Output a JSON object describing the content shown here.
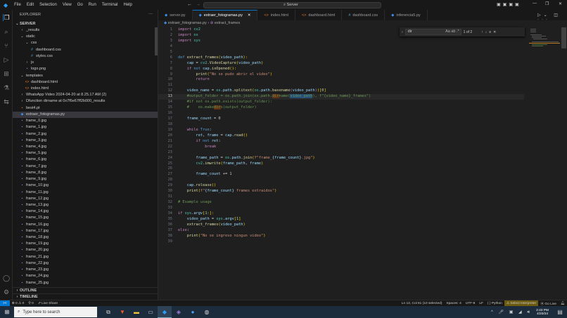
{
  "menu": [
    "File",
    "Edit",
    "Selection",
    "View",
    "Go",
    "Run",
    "Terminal",
    "Help"
  ],
  "search_text": "Server",
  "explorer": {
    "title": "EXPLORER",
    "root": "SERVER",
    "items": [
      {
        "label": "_results",
        "depth": 1,
        "icon": "chevron-right",
        "kind": "folder"
      },
      {
        "label": "static",
        "depth": 1,
        "icon": "chevron-down",
        "kind": "folder"
      },
      {
        "label": "css",
        "depth": 2,
        "icon": "chevron-down",
        "kind": "folder"
      },
      {
        "label": "dashboard.css",
        "depth": 3,
        "icon": "#",
        "kind": "css"
      },
      {
        "label": "styles.css",
        "depth": 3,
        "icon": "#",
        "kind": "css"
      },
      {
        "label": "js",
        "depth": 2,
        "icon": "chevron-right",
        "kind": "folder"
      },
      {
        "label": "logo.png",
        "depth": 2,
        "icon": "img",
        "kind": "png"
      },
      {
        "label": "templates",
        "depth": 1,
        "icon": "chevron-down",
        "kind": "folder"
      },
      {
        "label": "dashboard.html",
        "depth": 2,
        "icon": "<>",
        "kind": "html"
      },
      {
        "label": "index.html",
        "depth": 2,
        "icon": "<>",
        "kind": "html"
      },
      {
        "label": "WhatsApp Video 2024-04-20 at 8.25.17 AM (2)",
        "depth": 1,
        "icon": "chevron-right",
        "kind": "folder"
      },
      {
        "label": "Dfunction dirname at 0x7f6e67ff2b000_results",
        "depth": 1,
        "icon": "chevron-right",
        "kind": "folder"
      },
      {
        "label": "best4.pt",
        "depth": 1,
        "icon": "file",
        "kind": "pt"
      },
      {
        "label": "extraer_fotogramas.py",
        "depth": 1,
        "icon": "py",
        "kind": "py",
        "selected": true
      },
      {
        "label": "frame_0.jpg"
      },
      {
        "label": "frame_1.jpg"
      },
      {
        "label": "frame_2.jpg"
      },
      {
        "label": "frame_3.jpg"
      },
      {
        "label": "frame_4.jpg"
      },
      {
        "label": "frame_5.jpg"
      },
      {
        "label": "frame_6.jpg"
      },
      {
        "label": "frame_7.jpg"
      },
      {
        "label": "frame_8.jpg"
      },
      {
        "label": "frame_9.jpg"
      },
      {
        "label": "frame_10.jpg"
      },
      {
        "label": "frame_11.jpg"
      },
      {
        "label": "frame_12.jpg"
      },
      {
        "label": "frame_13.jpg"
      },
      {
        "label": "frame_14.jpg"
      },
      {
        "label": "frame_15.jpg"
      },
      {
        "label": "frame_16.jpg"
      },
      {
        "label": "frame_17.jpg"
      },
      {
        "label": "frame_18.jpg"
      },
      {
        "label": "frame_19.jpg"
      },
      {
        "label": "frame_20.jpg"
      },
      {
        "label": "frame_21.jpg"
      },
      {
        "label": "frame_22.jpg"
      },
      {
        "label": "frame_23.jpg"
      },
      {
        "label": "frame_24.jpg"
      },
      {
        "label": "frame_25.jpg"
      }
    ],
    "outline": "OUTLINE",
    "timeline": "TIMELINE"
  },
  "tabs": [
    {
      "label": "server.py",
      "kind": "py"
    },
    {
      "label": "extraer_fotogramas.py",
      "kind": "py",
      "active": true
    },
    {
      "label": "index.html",
      "kind": "html"
    },
    {
      "label": "dashboard.html",
      "kind": "html"
    },
    {
      "label": "dashboard.css",
      "kind": "css"
    },
    {
      "label": "inferencia5.py",
      "kind": "py"
    }
  ],
  "breadcrumb": {
    "file": "extraer_fotogramas.py",
    "symbol": "extract_frames"
  },
  "find": {
    "query": "dir",
    "options": "Aa ab .*",
    "count": "1 of 2"
  },
  "current_line": 13,
  "code": [
    [
      [
        "import ",
        "k"
      ],
      [
        "cv2",
        "m"
      ]
    ],
    [
      [
        "import ",
        "k"
      ],
      [
        "os",
        "m"
      ]
    ],
    [
      [
        "import ",
        "k"
      ],
      [
        "sys",
        "m"
      ]
    ],
    [],
    [],
    [
      [
        "def ",
        "d"
      ],
      [
        "extract_frames",
        "f"
      ],
      [
        "(",
        "b"
      ],
      [
        "video_path",
        "v"
      ],
      [
        "):",
        "b"
      ]
    ],
    [
      [
        "    cap ",
        "v"
      ],
      [
        "= ",
        "p"
      ],
      [
        "cv2",
        "m"
      ],
      [
        ".",
        "p"
      ],
      [
        "VideoCapture",
        "f"
      ],
      [
        "(",
        "b"
      ],
      [
        "video_path",
        "v"
      ],
      [
        ")",
        "b"
      ]
    ],
    [
      [
        "    if ",
        "k"
      ],
      [
        "not ",
        "d"
      ],
      [
        "cap",
        "v"
      ],
      [
        ".",
        "p"
      ],
      [
        "isOpened",
        "f"
      ],
      [
        "():",
        "b"
      ]
    ],
    [
      [
        "        print",
        "f"
      ],
      [
        "(",
        "b"
      ],
      [
        "\"No se pudo abrir el video\"",
        "s"
      ],
      [
        ")",
        "b"
      ]
    ],
    [
      [
        "        return",
        "k"
      ]
    ],
    [],
    [
      [
        "    video_name ",
        "v"
      ],
      [
        "= ",
        "p"
      ],
      [
        "os",
        "m"
      ],
      [
        ".path.",
        "v"
      ],
      [
        "splitext",
        "f"
      ],
      [
        "(",
        "b"
      ],
      [
        "os",
        "m"
      ],
      [
        ".path.",
        "v"
      ],
      [
        "basename",
        "f"
      ],
      [
        "(",
        "k"
      ],
      [
        "video_path",
        "v"
      ],
      [
        ")",
        "k"
      ],
      [
        ")",
        "b"
      ],
      [
        "[",
        "b"
      ],
      [
        "0",
        "n"
      ],
      [
        "]",
        "b"
      ]
    ],
    [
      [
        "    #output_folder = os.path.join(os.path.",
        "c"
      ],
      [
        "dir",
        "c hl"
      ],
      [
        "name(",
        "c"
      ],
      [
        "video_path",
        "c hs"
      ],
      [
        "), f\"{video_name}_frames\")",
        "c"
      ]
    ],
    [
      [
        "    #if not os.path.exists(output_folder):",
        "c"
      ]
    ],
    [
      [
        "    #    os.make",
        "c"
      ],
      [
        "dir",
        "c hl"
      ],
      [
        "s(output_folder)",
        "c"
      ]
    ],
    [],
    [
      [
        "    frame_count ",
        "v"
      ],
      [
        "= ",
        "p"
      ],
      [
        "0",
        "n"
      ]
    ],
    [],
    [
      [
        "    while ",
        "k"
      ],
      [
        "True",
        "d"
      ],
      [
        ":",
        "p"
      ]
    ],
    [
      [
        "        ret",
        "v"
      ],
      [
        ", ",
        "p"
      ],
      [
        "frame ",
        "v"
      ],
      [
        "= ",
        "p"
      ],
      [
        "cap",
        "v"
      ],
      [
        ".",
        "p"
      ],
      [
        "read",
        "f"
      ],
      [
        "()",
        "b"
      ]
    ],
    [
      [
        "        if ",
        "k"
      ],
      [
        "not ",
        "d"
      ],
      [
        "ret",
        "v"
      ],
      [
        ":",
        "p"
      ]
    ],
    [
      [
        "            break",
        "k"
      ]
    ],
    [],
    [
      [
        "        frame_path ",
        "v"
      ],
      [
        "= ",
        "p"
      ],
      [
        "os",
        "m"
      ],
      [
        ".path.",
        "v"
      ],
      [
        "join",
        "f"
      ],
      [
        "(",
        "b"
      ],
      [
        "f\"frame_",
        "s"
      ],
      [
        "{frame_count}",
        "v"
      ],
      [
        ".jpg\"",
        "s"
      ],
      [
        ")",
        "b"
      ]
    ],
    [
      [
        "        cv2",
        "m"
      ],
      [
        ".",
        "p"
      ],
      [
        "imwrite",
        "f"
      ],
      [
        "(",
        "b"
      ],
      [
        "frame_path",
        "v"
      ],
      [
        ", ",
        "p"
      ],
      [
        "frame",
        "v"
      ],
      [
        ")",
        "b"
      ]
    ],
    [],
    [
      [
        "        frame_count ",
        "v"
      ],
      [
        "+= ",
        "p"
      ],
      [
        "1",
        "n"
      ]
    ],
    [],
    [
      [
        "    cap",
        "v"
      ],
      [
        ".",
        "p"
      ],
      [
        "release",
        "f"
      ],
      [
        "()",
        "b"
      ]
    ],
    [
      [
        "    print",
        "f"
      ],
      [
        "(",
        "b"
      ],
      [
        "f\"",
        "s"
      ],
      [
        "{frame_count}",
        "v"
      ],
      [
        " frames extraidos\"",
        "s"
      ],
      [
        ")",
        "b"
      ]
    ],
    [],
    [
      [
        "# Example usage",
        "c"
      ]
    ],
    [],
    [
      [
        "if ",
        "k"
      ],
      [
        "sys",
        "m"
      ],
      [
        ".",
        "p"
      ],
      [
        "argv",
        "v"
      ],
      [
        "[",
        "b"
      ],
      [
        "1:",
        "n"
      ],
      [
        "]:",
        "b"
      ]
    ],
    [
      [
        "    video_path ",
        "v"
      ],
      [
        "= ",
        "p"
      ],
      [
        "sys",
        "m"
      ],
      [
        ".",
        "p"
      ],
      [
        "argv",
        "v"
      ],
      [
        "[",
        "b"
      ],
      [
        "1",
        "n"
      ],
      [
        "]",
        "b"
      ]
    ],
    [
      [
        "    extract_frames",
        "f"
      ],
      [
        "(",
        "b"
      ],
      [
        "video_path",
        "v"
      ],
      [
        ")",
        "b"
      ]
    ],
    [
      [
        "else",
        "k"
      ],
      [
        ":",
        "p"
      ]
    ],
    [
      [
        "    print",
        "f"
      ],
      [
        "(",
        "b"
      ],
      [
        "\"No se ingreso ningun video\"",
        "s"
      ],
      [
        ")",
        "b"
      ]
    ],
    []
  ],
  "status": {
    "remote": "><",
    "errors": "0",
    "warnings": "0",
    "ports": "0",
    "live_share": "Live Share",
    "position": "Ln 13, Col 61 (10 selected)",
    "spaces": "Spaces: 4",
    "encoding": "UTF-8",
    "eol": "LF",
    "language": "Python",
    "interpreter": "Select Interpreter",
    "go_live": "Go Live"
  },
  "taskbar": {
    "search_placeholder": "Type here to search",
    "time": "2:43 PM",
    "date": "4/20/24"
  },
  "colors": {
    "accent": "#0078d4",
    "interpreter_bg": "#6b5a10"
  }
}
